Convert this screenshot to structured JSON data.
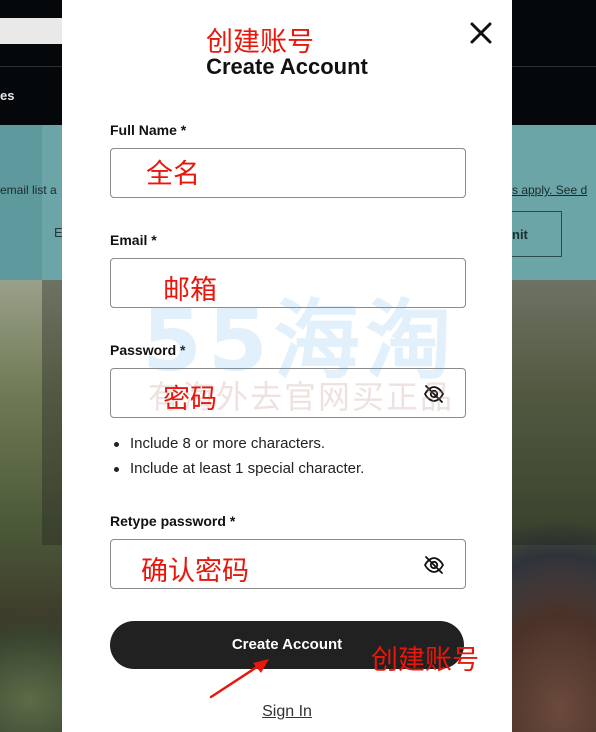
{
  "background": {
    "nav_text": "es",
    "banner_text": "email list a",
    "banner_link": "s apply. See d",
    "input_label": "E",
    "submit_label": "nit"
  },
  "modal": {
    "title": "Create Account",
    "close_label": "×",
    "fields": {
      "full_name": {
        "label": "Full Name *",
        "value": ""
      },
      "email": {
        "label": "Email *",
        "value": ""
      },
      "password": {
        "label": "Password *",
        "value": ""
      },
      "retype_password": {
        "label": "Retype password *",
        "value": ""
      }
    },
    "password_rules": [
      "Include 8 or more characters.",
      "Include at least 1 special character."
    ],
    "create_button": "Create Account",
    "sign_in_link": "Sign In"
  },
  "annotations": {
    "title": "创建账号",
    "full_name": "全名",
    "email": "邮箱",
    "password": "密码",
    "retype_password": "确认密码",
    "button": "创建账号",
    "color": "#e8170c"
  },
  "watermark": {
    "brand": "55海淘",
    "slogan": "有海外去官网买正品"
  },
  "icons": {
    "close": "close-icon",
    "password_visibility": "eye-slash-icon"
  }
}
